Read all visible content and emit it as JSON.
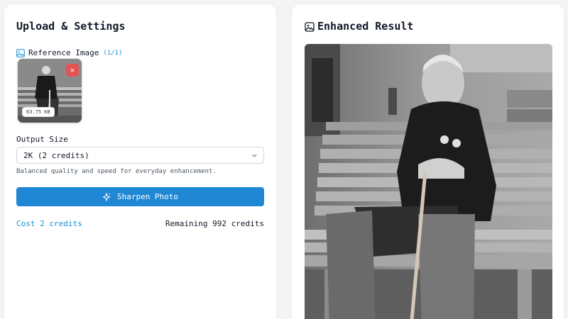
{
  "left_panel": {
    "title": "Upload & Settings",
    "reference": {
      "label": "Reference Image",
      "count": "(1/1)",
      "thumbnail_size": "63.75 KB",
      "delete_glyph": "✕"
    },
    "output_size": {
      "label": "Output Size",
      "selected": "2K (2 credits)",
      "hint": "Balanced quality and speed for everyday enhancement."
    },
    "action_button": "Sharpen Photo",
    "cost_text": "Cost 2 credits",
    "remaining_text": "Remaining 992 credits"
  },
  "right_panel": {
    "title": "Enhanced Result"
  },
  "colors": {
    "accent": "#1f87d4",
    "link": "#1d8fd6",
    "delete": "#e25555"
  }
}
